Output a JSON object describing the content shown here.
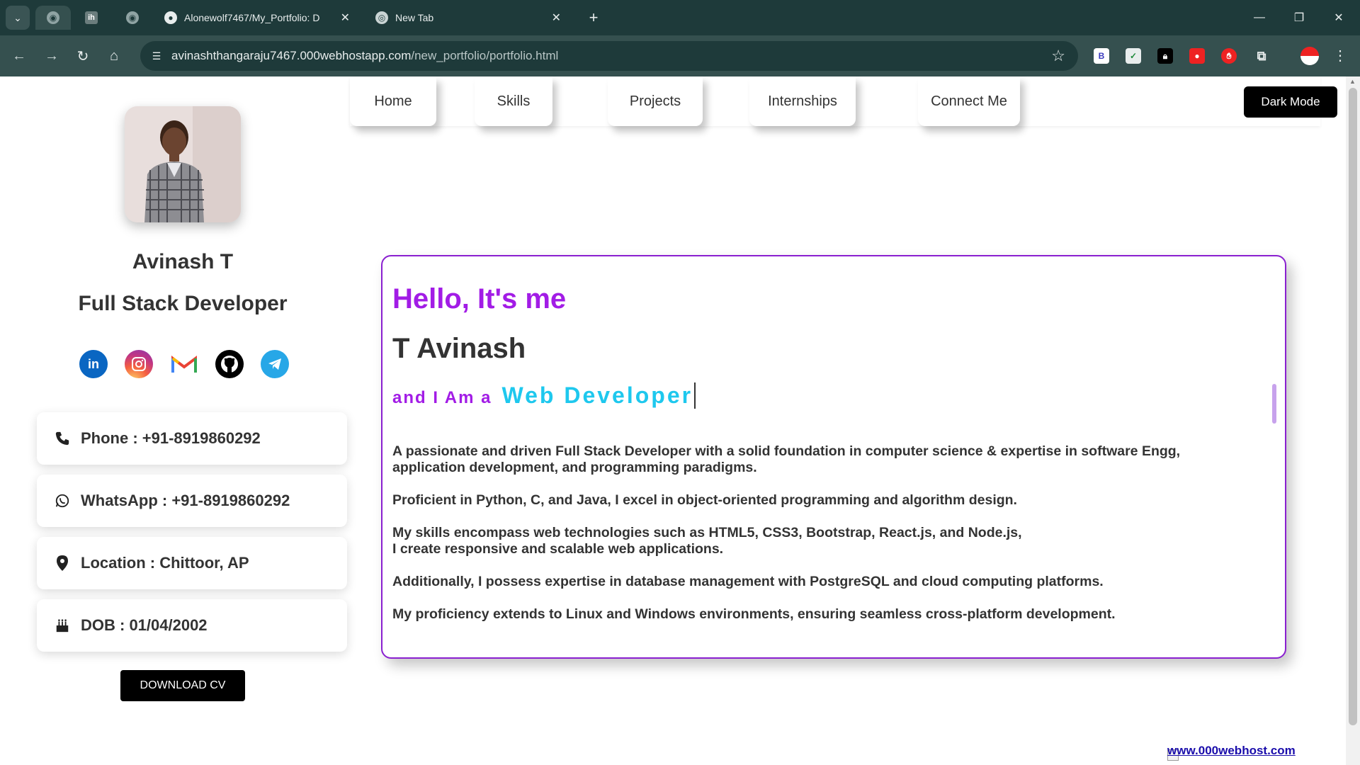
{
  "browser": {
    "tabs": [
      {
        "title": "",
        "icon": "globe-icon"
      },
      {
        "title": "",
        "icon": "ih-icon",
        "badge": "ih"
      },
      {
        "title": "",
        "icon": "globe-icon"
      },
      {
        "title": "Alonewolf7467/My_Portfolio: D",
        "icon": "github-icon"
      },
      {
        "title": "New Tab",
        "icon": "chrome-icon"
      }
    ],
    "url_host": "avinashthangaraju7467.000webhostapp.com",
    "url_path": "/new_portfolio/portfolio.html",
    "extensions": [
      "B"
    ]
  },
  "nav": {
    "items": [
      "Home",
      "Skills",
      "Projects",
      "Internships",
      "Connect Me"
    ],
    "dark_mode_label": "Dark Mode"
  },
  "profile": {
    "name": "Avinash T",
    "role": "Full Stack Developer",
    "social": [
      "linkedin-icon",
      "instagram-icon",
      "gmail-icon",
      "github-icon",
      "telegram-icon"
    ],
    "phone": "Phone : +91-8919860292",
    "whatsapp": "WhatsApp : +91-8919860292",
    "location": "Location : Chittoor, AP",
    "dob": "DOB : 01/04/2002",
    "download_label": "DOWNLOAD CV"
  },
  "about": {
    "hello": "Hello, It's me",
    "fullname": "T Avinash",
    "iam": "and I Am a",
    "typed": "Web Developer",
    "p1a": "A passionate and driven Full Stack Developer with a solid foundation in computer science & expertise in software Engg,",
    "p1b": "application development, and programming paradigms.",
    "p2": "Proficient in Python, C, and Java, I excel in object-oriented programming and algorithm design.",
    "p3a": "My skills encompass web technologies such as HTML5, CSS3, Bootstrap, React.js, and Node.js,",
    "p3b": "I create responsive and scalable web applications.",
    "p4": "Additionally, I possess expertise in database management with PostgreSQL and cloud computing platforms.",
    "p5": "My proficiency extends to Linux and Windows environments, ensuring seamless cross-platform development."
  },
  "footer": {
    "link": "www.000webhost.com"
  },
  "colors": {
    "accent_purple": "#a21ce6",
    "accent_cyan": "#1ec8ee",
    "border_purple": "#8a20d0"
  }
}
